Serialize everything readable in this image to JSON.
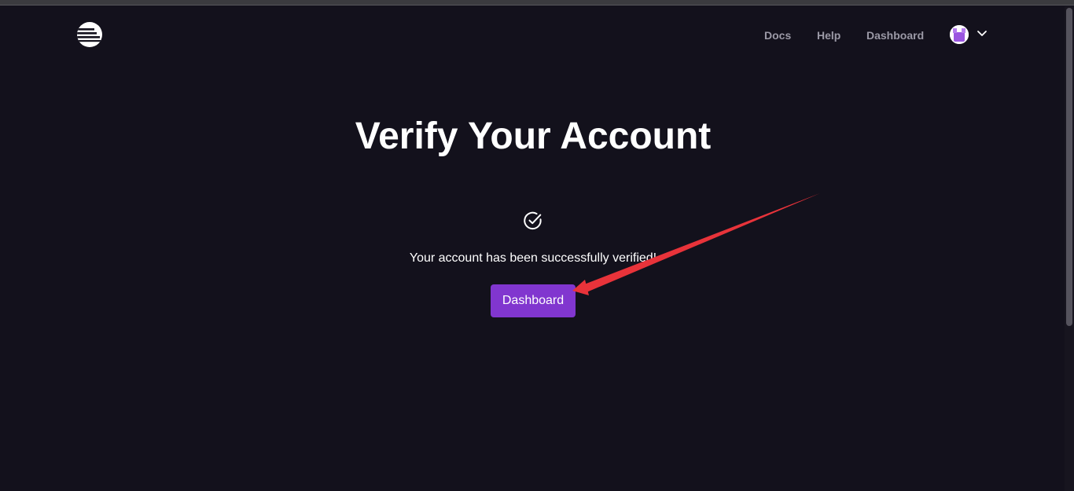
{
  "nav": {
    "links": [
      {
        "label": "Docs"
      },
      {
        "label": "Help"
      },
      {
        "label": "Dashboard"
      }
    ],
    "logo_icon": "brand-logo-icon",
    "avatar_icon": "user-avatar-icon",
    "menu_icon": "chevron-down-icon"
  },
  "main": {
    "title": "Verify Your Account",
    "status_icon": "check-circle-icon",
    "message": "Your account has been successfully verified!",
    "button_label": "Dashboard"
  },
  "annotation": {
    "type": "arrow",
    "color": "#e8333a",
    "points_to": "dashboard-button"
  },
  "colors": {
    "background": "#13111c",
    "accent": "#8136cf",
    "nav_text": "#9b99a6",
    "text": "#ffffff"
  }
}
